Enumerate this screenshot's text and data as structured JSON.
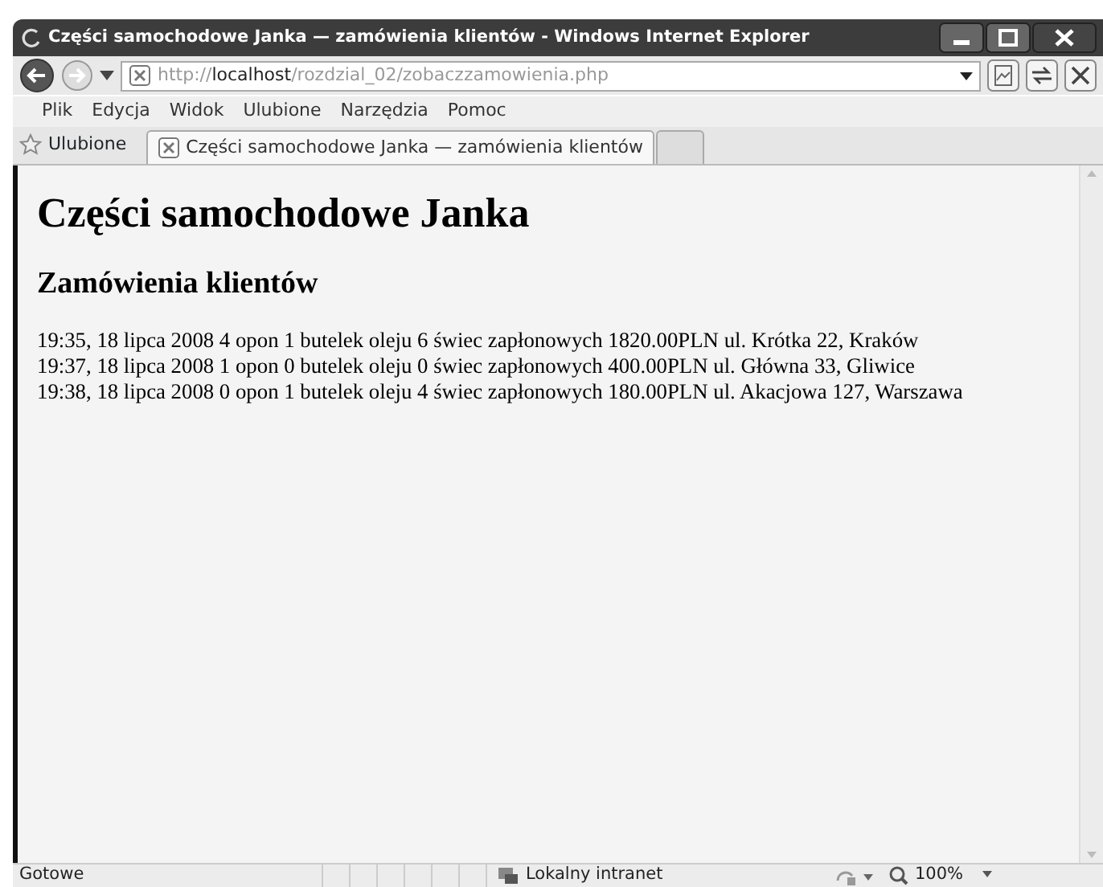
{
  "window": {
    "title": "Części samochodowe Janka — zamówienia klientów - Windows Internet Explorer"
  },
  "address": {
    "scheme": "http://",
    "host": "localhost",
    "path": "/rozdzial_02/zobaczzamowienia.php"
  },
  "menu": [
    "Plik",
    "Edycja",
    "Widok",
    "Ulubione",
    "Narzędzia",
    "Pomoc"
  ],
  "favorites": {
    "label": "Ulubione"
  },
  "tabs": [
    {
      "label": "Części samochodowe Janka — zamówienia klientów",
      "selected": true
    }
  ],
  "page": {
    "heading": "Części samochodowe Janka",
    "subheading": "Zamówienia klientów",
    "orders": [
      "19:35, 18 lipca 2008 4 opon 1 butelek oleju 6 świec zapłonowych 1820.00PLN ul. Krótka 22, Kraków",
      "19:37, 18 lipca 2008 1 opon 0 butelek oleju 0 świec zapłonowych 400.00PLN ul. Główna 33, Gliwice",
      "19:38, 18 lipca 2008 0 opon 1 butelek oleju 4 świec zapłonowych 180.00PLN ul. Akacjowa 127, Warszawa"
    ]
  },
  "status_bar": {
    "status": "Gotowe",
    "zone": "Lokalny intranet",
    "zoom": "100%"
  }
}
